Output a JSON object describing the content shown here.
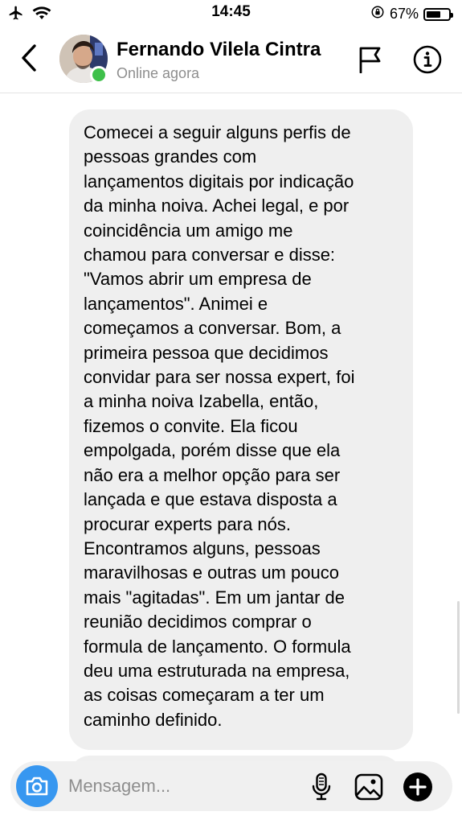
{
  "status_bar": {
    "time": "14:45",
    "battery_percent": "67%",
    "battery_level": 0.67,
    "icons": [
      "airplane-icon",
      "wifi-icon",
      "orientation-lock-icon",
      "battery-icon"
    ]
  },
  "header": {
    "contact_name": "Fernando Vilela Cintra",
    "contact_status": "Online agora",
    "online_color": "#3ec04a",
    "icons": [
      "back-chevron-icon",
      "flag-icon",
      "info-icon"
    ]
  },
  "chat": {
    "bubble_color": "#efefef",
    "messages": [
      {
        "text": "Comecei a seguir alguns perfis de\npessoas grandes com\nlançamentos digitais por indicação\nda minha noiva. Achei legal, e por\ncoincidência um amigo me\nchamou para conversar e disse:\n\"Vamos abrir um empresa de\nlançamentos\". Animei e\ncomeçamos a conversar.  Bom, a\nprimeira pessoa que decidimos\nconvidar para ser nossa expert, foi\na minha noiva Izabella, então,\nfizemos o convite. Ela ficou\nempolgada, porém disse que ela\nnão era a melhor opção para ser\nlançada e que estava disposta a\nprocurar experts para nós.\nEncontramos alguns, pessoas\nmaravilhosas e outras um pouco\nmais \"agitadas\". Em um jantar de\nreunião decidimos comprar o\nformula de lançamento. O formula\ndeu uma estruturada na empresa,\nas coisas começaram a ter um\ncaminho definido."
      }
    ]
  },
  "composer": {
    "placeholder": "Mensagem...",
    "value": "",
    "accent_color": "#3797f0",
    "icons": [
      "camera-icon",
      "microphone-icon",
      "gallery-icon",
      "plus-icon"
    ]
  }
}
